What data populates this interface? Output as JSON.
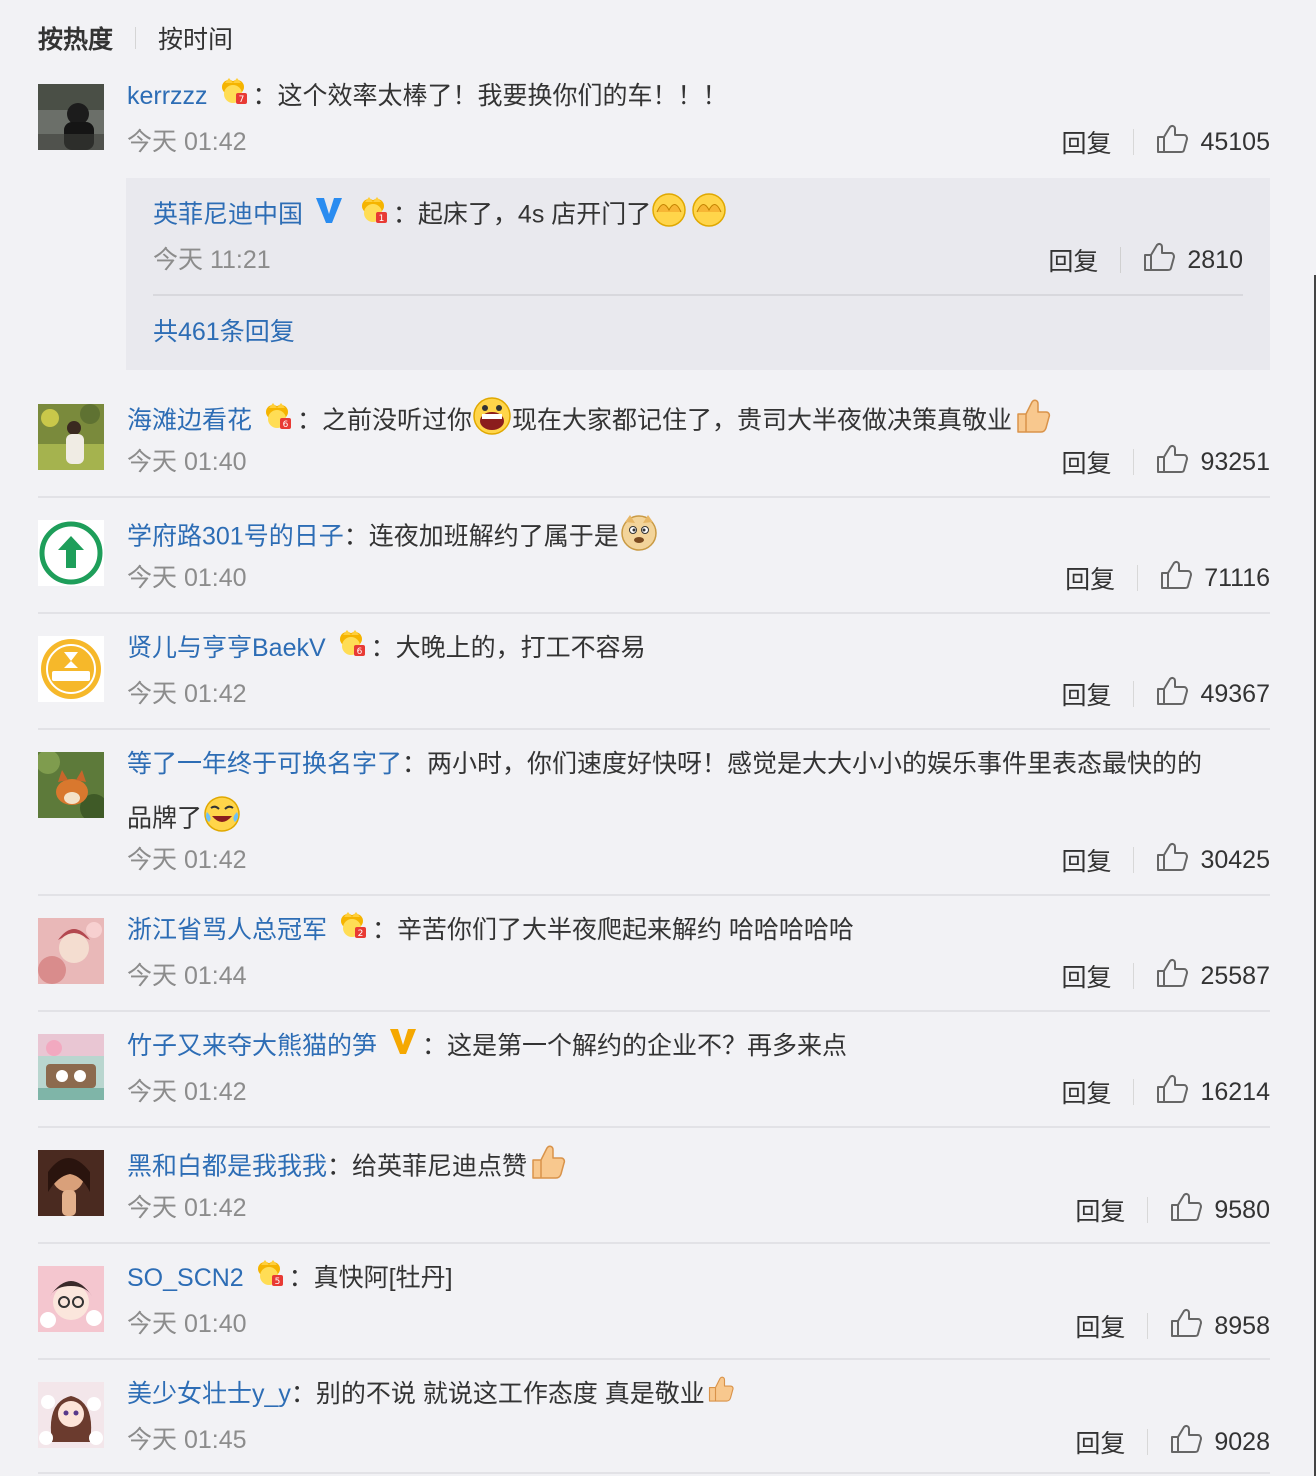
{
  "sort": {
    "hot": "按热度",
    "time": "按时间"
  },
  "reply_label": "回复",
  "comments": [
    {
      "user": "kerrzzz",
      "text": "：这个效率太棒了！我要换你们的车！！！",
      "time": "今天 01:42",
      "likes": "45105"
    },
    {
      "user": "海滩边看花",
      "text": "：之前没听过你",
      "text2": "现在大家都记住了，贵司大半夜做决策真敬业",
      "time": "今天 01:40",
      "likes": "93251"
    },
    {
      "user": "学府路301号的日子",
      "text": "：连夜加班解约了属于是",
      "time": "今天 01:40",
      "likes": "71116"
    },
    {
      "user": "贤儿与亨亨BaekV",
      "text": "：大晚上的，打工不容易",
      "time": "今天 01:42",
      "likes": "49367"
    },
    {
      "user": "等了一年终于可换名字了",
      "text": "：两小时，你们速度好快呀！感觉是大大小小的娱乐事件里表态最快的的",
      "text_line2": "品牌了",
      "time": "今天 01:42",
      "likes": "30425"
    },
    {
      "user": "浙江省骂人总冠军",
      "text": "：辛苦你们了大半夜爬起来解约 哈哈哈哈哈",
      "time": "今天 01:44",
      "likes": "25587"
    },
    {
      "user": "竹子又来夺大熊猫的笋",
      "text": "：这是第一个解约的企业不？再多来点",
      "time": "今天 01:42",
      "likes": "16214"
    },
    {
      "user": "黑和白都是我我我",
      "text": "：给英菲尼迪点赞",
      "time": "今天 01:42",
      "likes": "9580"
    },
    {
      "user": "SO_SCN2",
      "text": "：真快阿[牡丹]",
      "time": "今天 01:40",
      "likes": "8958"
    },
    {
      "user": "美少女壮士y_y",
      "text": "：别的不说  就说这工作态度 真是敬业",
      "time": "今天 01:45",
      "likes": "9028"
    }
  ],
  "subreply": {
    "user": "英菲尼迪中国",
    "text": "：起床了，4s 店开门了",
    "time": "今天 11:21",
    "likes": "2810",
    "more": "共461条回复"
  },
  "colors": {
    "link": "#2d6db5",
    "background": "#f2f2f5",
    "meta": "#8c8c8c"
  }
}
